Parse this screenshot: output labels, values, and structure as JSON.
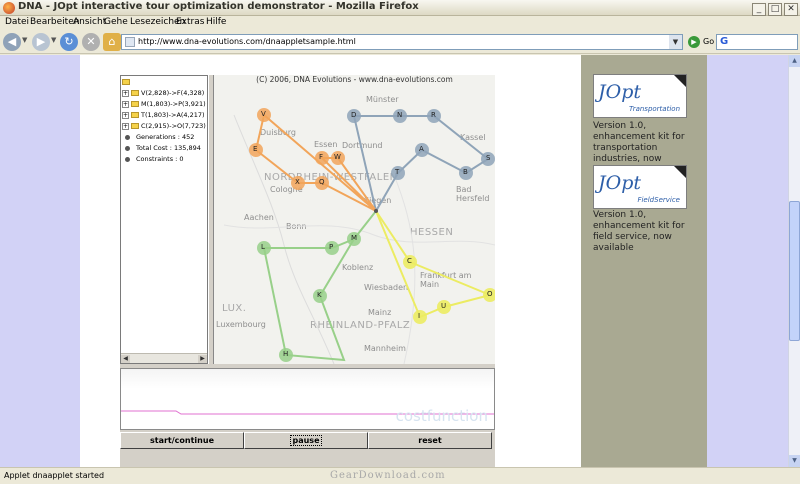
{
  "browser": {
    "title": "DNA - JOpt interactive tour optimization demonstrator - Mozilla Firefox",
    "menu": [
      "Datei",
      "Bearbeiten",
      "Ansicht",
      "Gehe",
      "Lesezeichen",
      "Extras",
      "Hilfe"
    ],
    "url": "http://www.dna-evolutions.com/dnaappletsample.html",
    "go_label": "Go",
    "status": "Applet dnaapplet started",
    "watermark": "GearDownload.com"
  },
  "applet": {
    "tree": {
      "items": [
        "V(2,828)->F(4,328)",
        "M(1,803)->P(3,921)",
        "T(1,803)->A(4,217)",
        "C(2,915)->O(7,723)"
      ],
      "stats": [
        "Generations : 452",
        "Total Cost : 135,894",
        "Constraints : 0"
      ]
    },
    "map": {
      "copyright": "(C) 2006, DNA Evolutions - www.dna-evolutions.com",
      "place_labels": [
        "Münster",
        "Duisburg",
        "Essen",
        "Dortmund",
        "NORDRHEIN-WESTFALEN",
        "Cologne",
        "Siegen",
        "Aachen",
        "Bonn",
        "HESSEN",
        "Koblenz",
        "Frankfurt am Main",
        "Wiesbaden",
        "Mainz",
        "RHEINLAND-PFALZ",
        "LUX.",
        "Luxembourg",
        "Mannheim",
        "Bad Hersfeld",
        "Kassel"
      ],
      "nodes": {
        "blue": [
          "D",
          "N",
          "R",
          "A",
          "S",
          "B",
          "T"
        ],
        "orange": [
          "V",
          "E",
          "F",
          "W",
          "X",
          "Q"
        ],
        "green": [
          "L",
          "P",
          "M",
          "K",
          "H"
        ],
        "yellow": [
          "C",
          "O",
          "U",
          "I"
        ]
      },
      "colors": {
        "blue": "#8fa4b8",
        "orange": "#f2a55a",
        "green": "#98d089",
        "yellow": "#ecec62"
      }
    },
    "cost_label": "costfunction",
    "buttons": {
      "start": "start/continue",
      "pause": "pause",
      "reset": "reset"
    }
  },
  "sidebar": {
    "ads": [
      {
        "logo": "JOpt",
        "sub": "Transportation",
        "text": "Version 1.0, enhancement kit for transportation industries, now available"
      },
      {
        "logo": "JOpt",
        "sub": "FieldService",
        "text": "Version 1.0, enhancement kit for field service, now available"
      }
    ]
  }
}
